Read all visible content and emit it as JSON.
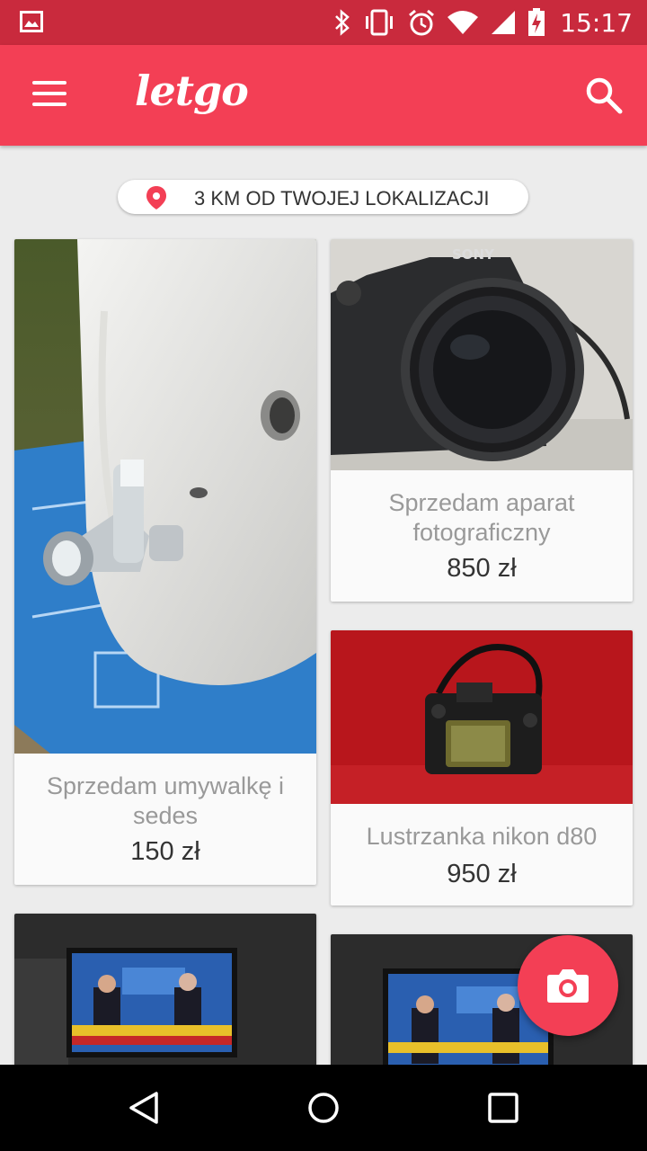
{
  "status_bar": {
    "time": "15:17",
    "icons": [
      "gallery-icon",
      "bluetooth-icon",
      "vibrate-icon",
      "alarm-icon",
      "wifi-icon",
      "signal-icon",
      "battery-charging-icon"
    ]
  },
  "app_bar": {
    "logo": "letgo",
    "menu_icon": "hamburger-menu-icon",
    "search_icon": "search-icon",
    "color": "#f33f55"
  },
  "location_filter": {
    "label": "3 KM OD TWOJEJ LOKALIZACJI",
    "icon": "location-pin-icon"
  },
  "listings": [
    {
      "title": "Sprzedam umywalkę i sedes",
      "price": "150 zł",
      "image": "sink-faucet-photo"
    },
    {
      "title": "Sprzedam aparat fotograficzny",
      "price": "850 zł",
      "image": "sony-camera-photo"
    },
    {
      "title": "Lustrzanka nikon d80",
      "price": "950 zł",
      "image": "nikon-camera-on-red-carpet-photo"
    },
    {
      "title": "",
      "price": "",
      "image": "tv-broadcast-photo"
    },
    {
      "title": "",
      "price": "",
      "image": "tv-broadcast-photo"
    }
  ],
  "fab": {
    "icon": "camera-icon"
  },
  "nav_bar": {
    "icons": [
      "back-icon",
      "home-icon",
      "recents-icon"
    ]
  }
}
